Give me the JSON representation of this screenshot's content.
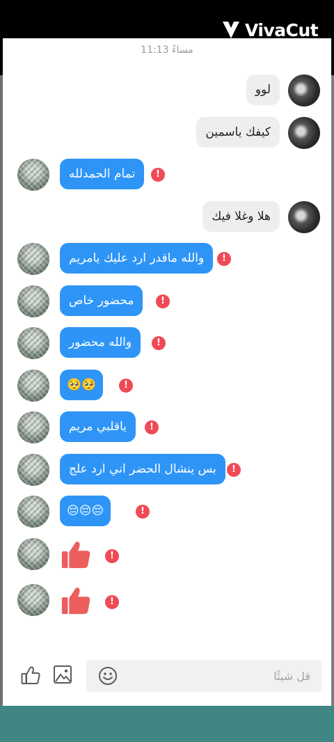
{
  "watermark": {
    "text": "VivaCut"
  },
  "timestamp": "11:13 مساءً",
  "messages": [
    {
      "side": "in",
      "type": "text",
      "text": "لوو"
    },
    {
      "side": "in",
      "type": "text",
      "text": "كيفك ياسمين"
    },
    {
      "side": "out",
      "type": "text",
      "text": "تمام الحمدلله",
      "error": true
    },
    {
      "side": "in",
      "type": "text",
      "text": "هلا وغلا فيك"
    },
    {
      "side": "out",
      "type": "text",
      "text": "والله ماقدر ارد عليك يامريم",
      "error": true
    },
    {
      "side": "out",
      "type": "text",
      "text": "محضور خاص",
      "error": true
    },
    {
      "side": "out",
      "type": "text",
      "text": "والله محضور",
      "error": true
    },
    {
      "side": "out",
      "type": "text",
      "text": "🥺🥺",
      "error": true
    },
    {
      "side": "out",
      "type": "text",
      "text": "ياقلبي مريم",
      "error": true
    },
    {
      "side": "out",
      "type": "text",
      "text": "بس ينشال الحضر اني ارد علج",
      "error": true
    },
    {
      "side": "out",
      "type": "text",
      "text": "😔😔😔",
      "error": true
    },
    {
      "side": "out",
      "type": "like",
      "icon": "thumbs-up-sticker",
      "error": true
    },
    {
      "side": "out",
      "type": "like",
      "icon": "thumbs-up-sticker",
      "error": true
    }
  ],
  "error_badge": "!",
  "composer": {
    "placeholder": "قل شيئًا",
    "value": "",
    "icons": [
      "emoji-icon",
      "image-icon",
      "like-icon"
    ]
  },
  "colors": {
    "outgoing_bubble": "#2e95f7",
    "incoming_bubble": "#eeeeee",
    "error_badge": "#ef4a55",
    "like_sticker": "#ec5d5d"
  }
}
